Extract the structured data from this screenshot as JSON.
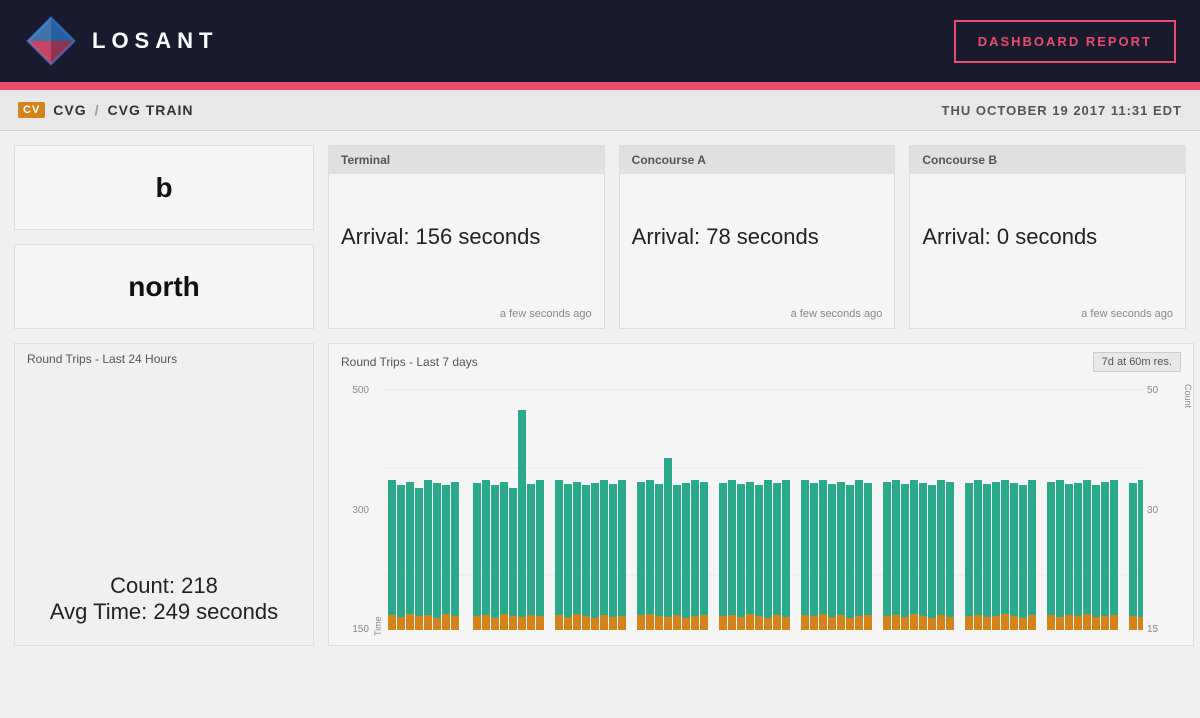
{
  "header": {
    "logo_text": "LOSANT",
    "dashboard_btn": "DASHBOARD REPORT"
  },
  "breadcrumb": {
    "badge": "CV",
    "parent": "CVG",
    "separator": "/",
    "current": "CVG TRAIN",
    "timestamp": "THU OCTOBER 19 2017 11:31 EDT"
  },
  "left_panels": {
    "top_value": "b",
    "bottom_value": "north"
  },
  "terminal": {
    "header": "Terminal",
    "arrival": "Arrival: 156 seconds",
    "timestamp": "a few seconds ago"
  },
  "concourse_a": {
    "header": "Concourse A",
    "arrival": "Arrival: 78 seconds",
    "timestamp": "a few seconds ago"
  },
  "concourse_b": {
    "header": "Concourse B",
    "arrival": "Arrival: 0 seconds",
    "timestamp": "a few seconds ago"
  },
  "round_trips_24h": {
    "title": "Round Trips - Last 24 Hours",
    "count": "Count: 218",
    "avg_time": "Avg Time: 249 seconds"
  },
  "round_trips_7d": {
    "title": "Round Trips - Last 7 days",
    "badge": "7d at 60m res.",
    "y_left_top": "500",
    "y_left_mid": "300",
    "y_left_bot": "150",
    "y_right_top": "50",
    "y_right_mid": "30",
    "y_right_bot": "15",
    "y_left_label": "Time",
    "y_right_label": "Count"
  },
  "colors": {
    "teal": "#2aaa8a",
    "orange": "#d4821a",
    "red_bar": "#e84c6e",
    "header_bg": "#1a1a2e"
  }
}
